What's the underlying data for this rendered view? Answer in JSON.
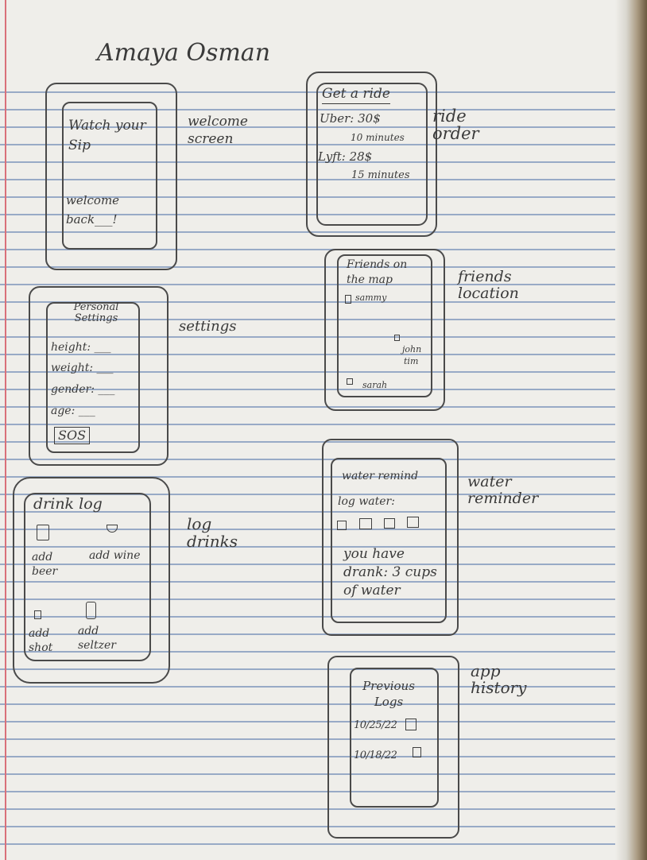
{
  "author": "Amaya Osman",
  "screens": {
    "welcome": {
      "label": "welcome screen",
      "title": "Watch your Sip",
      "greeting": "welcome back___!"
    },
    "settings": {
      "label": "settings",
      "title": "Personal Settings",
      "fields": [
        "height: ___",
        "weight: ___",
        "gender: ___",
        "age: ___"
      ],
      "sos": "SOS"
    },
    "drink_log": {
      "label": "log drinks",
      "title": "drink log",
      "buttons": [
        "add beer",
        "add wine",
        "add shot",
        "add seltzer"
      ]
    },
    "ride_order": {
      "label": "ride order",
      "title": "Get a ride",
      "options": [
        {
          "service": "Uber: 30$",
          "time": "10 minutes"
        },
        {
          "service": "Lyft: 28$",
          "time": "15 minutes"
        }
      ]
    },
    "friends_location": {
      "label": "friends location",
      "title": "Friends on the map",
      "friends": [
        "sammy",
        "john",
        "tim",
        "sarah"
      ]
    },
    "water_reminder": {
      "label": "water reminder",
      "title": "water remind",
      "log_label": "log water:",
      "status": "you have drank: 3 cups of water"
    },
    "app_history": {
      "label": "app history",
      "title": "Previous Logs",
      "logs": [
        "10/25/22",
        "10/18/22"
      ]
    }
  }
}
